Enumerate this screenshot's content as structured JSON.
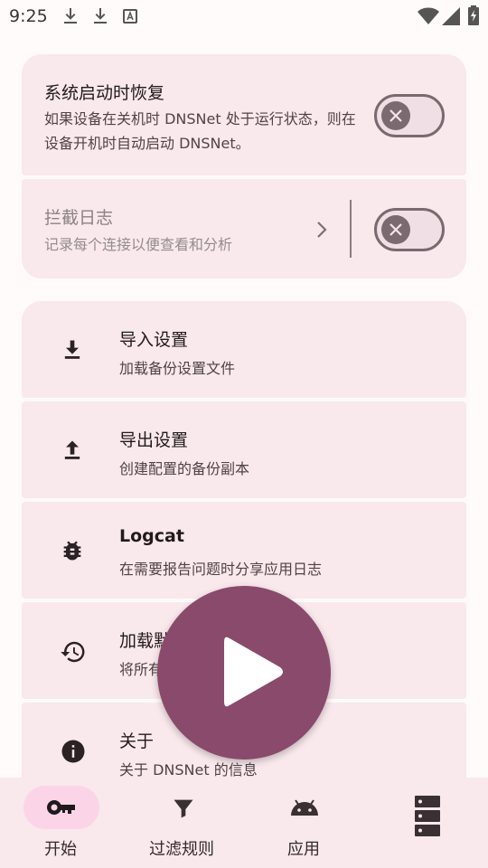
{
  "status_bar": {
    "time": "9:25",
    "left_icons": [
      "download-icon",
      "download-icon",
      "font-icon"
    ],
    "right_icons": [
      "wifi-icon",
      "signal-icon",
      "battery-charging-icon"
    ]
  },
  "settings": {
    "restore_on_boot": {
      "title": "系统启动时恢复",
      "description": "如果设备在关机时 DNSNet 处于运行状态，则在设备开机时自动启动 DNSNet。",
      "enabled": false
    },
    "block_log": {
      "title": "拦截日志",
      "description": "记录每个连接以便查看和分析",
      "enabled": false
    }
  },
  "actions": [
    {
      "title": "导入设置",
      "description": "加载备份设置文件",
      "icon": "download-icon"
    },
    {
      "title": "导出设置",
      "description": "创建配置的备份副本",
      "icon": "upload-icon"
    },
    {
      "title": "Logcat",
      "description": "在需要报告问题时分享应用日志",
      "icon": "bug-icon"
    },
    {
      "title": "加载默认设置",
      "description": "将所有设置恢复为默认值",
      "icon": "restore-icon"
    },
    {
      "title": "关于",
      "description": "关于 DNSNet 的信息",
      "icon": "info-icon"
    }
  ],
  "fab": {
    "icon": "play-icon"
  },
  "bottom_nav": [
    {
      "label": "开始",
      "icon": "key-icon",
      "active": true
    },
    {
      "label": "过滤规则",
      "icon": "filter-icon",
      "active": false
    },
    {
      "label": "应用",
      "icon": "android-icon",
      "active": false
    },
    {
      "label": "",
      "icon": "dns-server-icon",
      "active": false
    }
  ],
  "colors": {
    "background": "#fffbfa",
    "card": "#f9e8ec",
    "accent": "#8a4a6b",
    "active_pill": "#fcd4e8",
    "toggle_outline": "#7a6a70"
  }
}
